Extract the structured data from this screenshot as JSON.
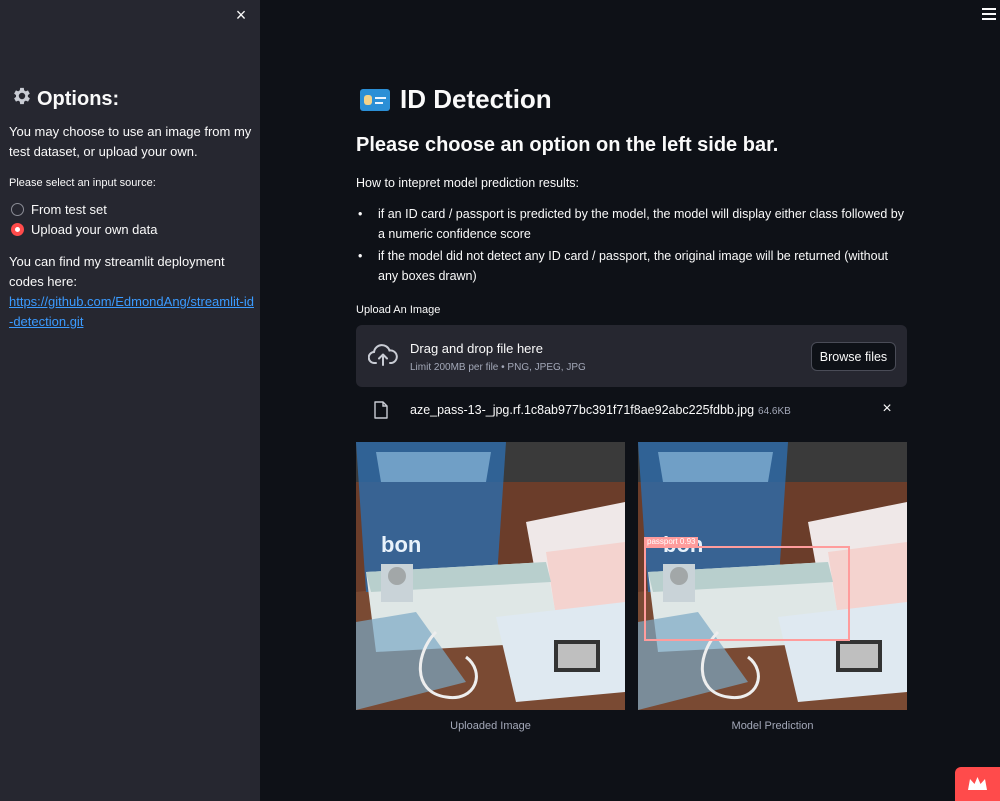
{
  "sidebar": {
    "close_label": "×",
    "title": "Options:",
    "title_icon": "gear-icon",
    "intro": "You may choose to use an image from my test dataset, or upload your own.",
    "input_label": "Please select an input source:",
    "radio_options": [
      {
        "label": "From test set",
        "selected": false
      },
      {
        "label": "Upload your own data",
        "selected": true
      }
    ],
    "codes_text": "You can find my streamlit deployment codes here:",
    "codes_link": "https://github.com/EdmondAng/streamlit-id-detection.git"
  },
  "main": {
    "title": "ID Detection",
    "title_icon": "id-card-icon",
    "subheader": "Please choose an option on the left side bar.",
    "intro": "How to intepret model prediction results:",
    "bullets": [
      "if an ID card / passport is predicted by the model, the model will display either class followed by a numeric confidence score",
      "if the model did not detect any ID card / passport, the original image will be returned (without any boxes drawn)"
    ],
    "upload_label": "Upload An Image",
    "dropzone": {
      "title": "Drag and drop file here",
      "limit": "Limit 200MB per file • PNG, JPEG, JPG",
      "browse_label": "Browse files"
    },
    "file": {
      "name": "aze_pass-13-_jpg.rf.1c8ab977bc391f71f8ae92abc225fdbb.jpg",
      "size": "64.6KB"
    },
    "images": [
      {
        "caption": "Uploaded Image"
      },
      {
        "caption": "Model Prediction",
        "detection_label": "passport 0.93"
      }
    ]
  },
  "colors": {
    "background": "#0e1117",
    "sidebar": "#262730",
    "accent": "#ff4b4b",
    "link": "#3b9bff",
    "bbox": "#ff9c9c"
  }
}
